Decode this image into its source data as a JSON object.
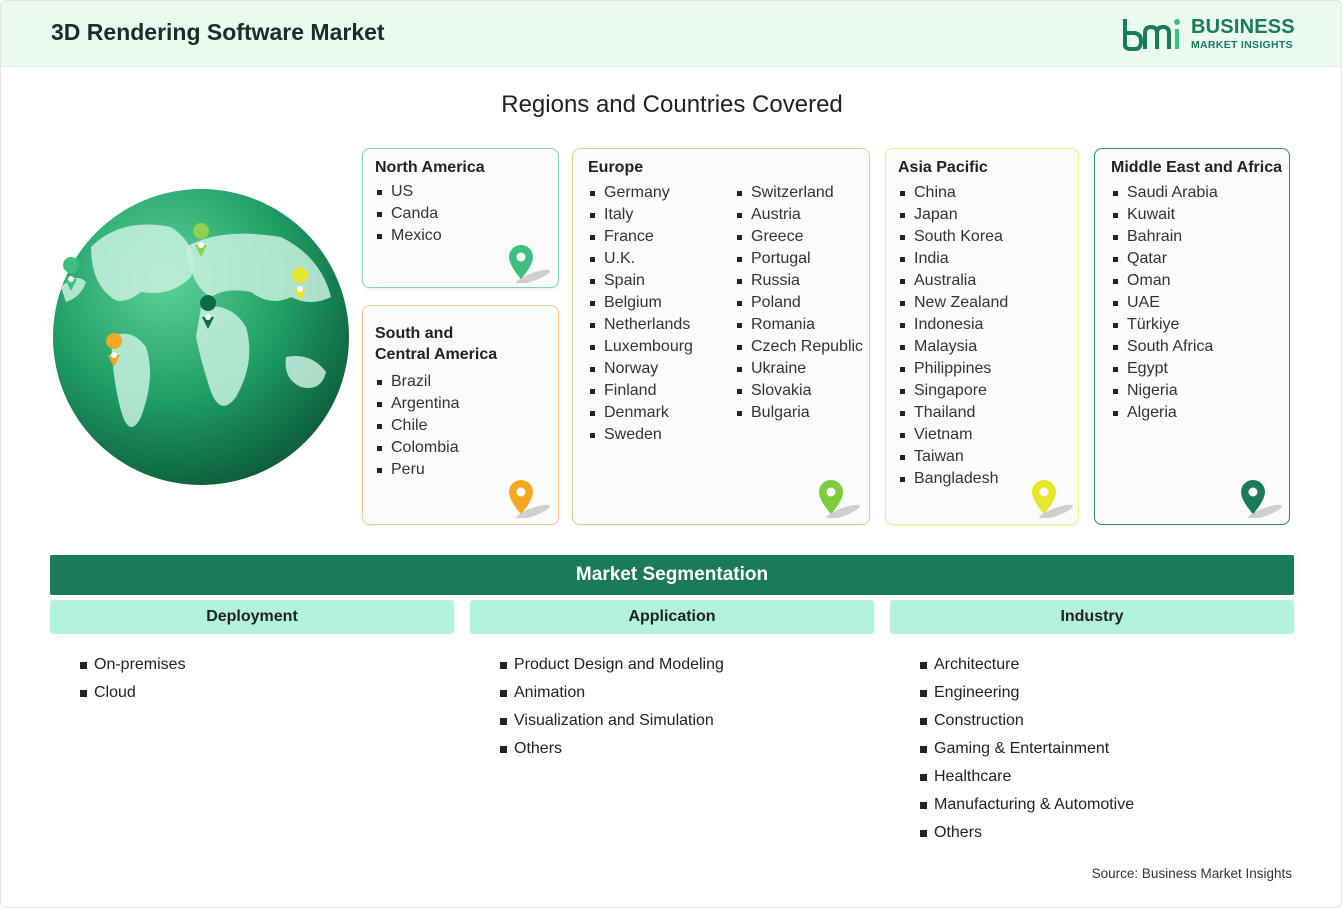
{
  "header": {
    "title": "3D Rendering Software Market",
    "logo_line1": "BUSINESS",
    "logo_line2": "MARKET INSIGHTS",
    "brand_color": "#1a7a5a"
  },
  "regions_title": "Regions and Countries Covered",
  "regions": {
    "north_america": {
      "title": "North America",
      "countries": [
        "US",
        "Canda",
        "Mexico"
      ],
      "color": "#3fbf7f"
    },
    "south_central_america": {
      "title_line1": "South and",
      "title_line2": "Central America",
      "countries": [
        "Brazil",
        "Argentina",
        "Chile",
        "Colombia",
        "Peru"
      ],
      "color": "#f5a623"
    },
    "europe": {
      "title": "Europe",
      "countries_col1": [
        "Germany",
        "Italy",
        "France",
        "U.K.",
        "Spain",
        "Belgium",
        "Netherlands",
        "Luxembourg",
        "Norway",
        "Finland",
        "Denmark",
        "Sweden"
      ],
      "countries_col2": [
        "Switzerland",
        "Austria",
        "Greece",
        "Portugal",
        "Russia",
        "Poland",
        "Romania",
        "Czech Republic",
        "Ukraine",
        "Slovakia",
        "Bulgaria"
      ],
      "color": "#7ccc3c"
    },
    "asia_pacific": {
      "title": "Asia Pacific",
      "countries": [
        "China",
        "Japan",
        "South Korea",
        "India",
        "Australia",
        "New Zealand",
        "Indonesia",
        "Malaysia",
        "Philippines",
        "Singapore",
        "Thailand",
        "Vietnam",
        "Taiwan",
        "Bangladesh"
      ],
      "color": "#e6e62e"
    },
    "mea": {
      "title": "Middle East and Africa",
      "countries": [
        "Saudi Arabia",
        "Kuwait",
        "Bahrain",
        "Qatar",
        "Oman",
        "UAE",
        "Türkiye",
        "South Africa",
        "Egypt",
        "Nigeria",
        "Algeria"
      ],
      "color": "#1a7a5a"
    }
  },
  "segmentation": {
    "title": "Market Segmentation",
    "columns": [
      {
        "heading": "Deployment",
        "items": [
          "On-premises",
          "Cloud"
        ]
      },
      {
        "heading": "Application",
        "items": [
          "Product Design and Modeling",
          "Animation",
          "Visualization and Simulation",
          "Others"
        ]
      },
      {
        "heading": "Industry",
        "items": [
          "Architecture",
          "Engineering",
          "Construction",
          "Gaming & Entertainment",
          "Healthcare",
          "Manufacturing & Automotive",
          "Others"
        ]
      }
    ]
  },
  "source": "Source: Business Market Insights",
  "icons": {
    "globe": "globe-icon",
    "pin": "map-pin-icon",
    "logo": "bmi-logo-icon"
  }
}
